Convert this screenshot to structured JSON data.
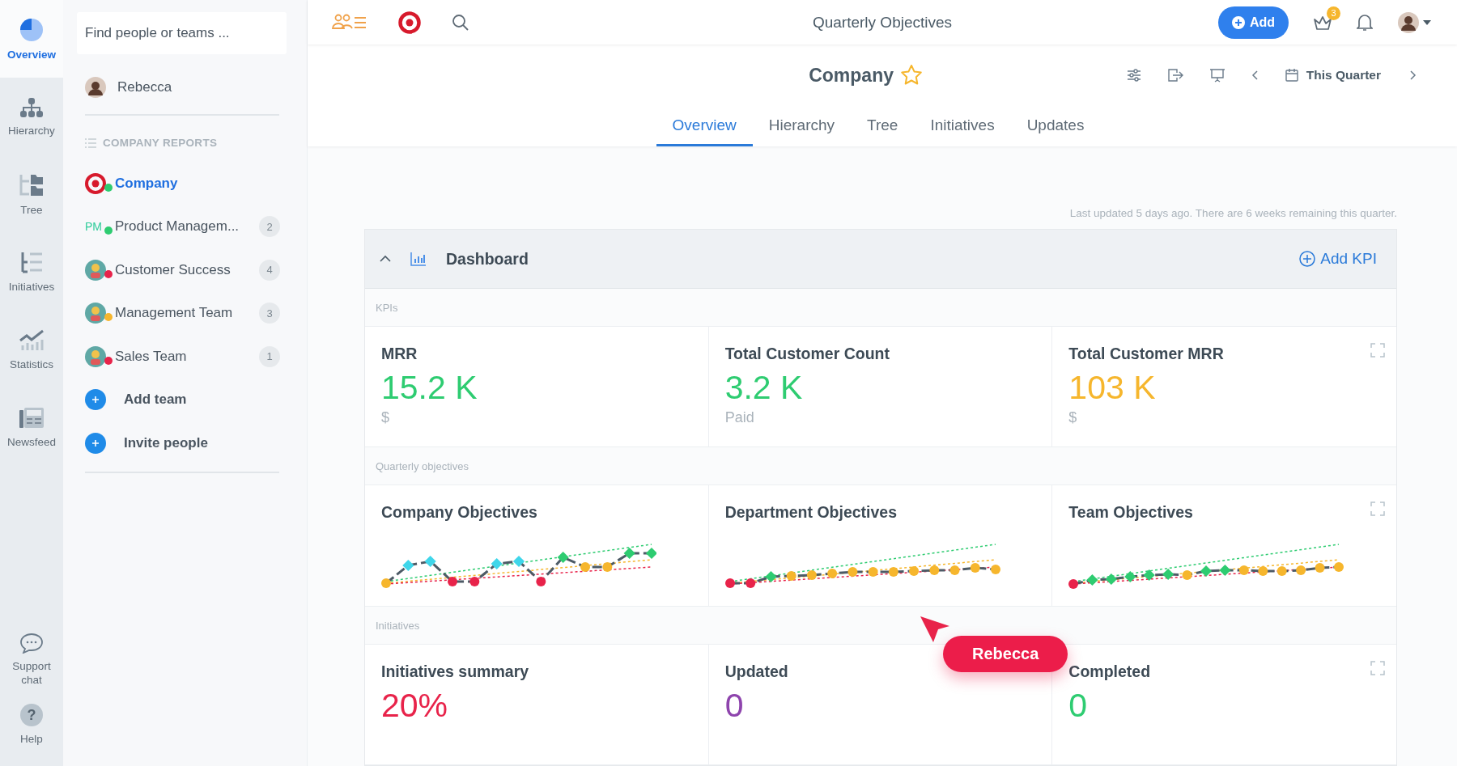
{
  "rail": {
    "items": [
      {
        "label": "Overview",
        "selected": true
      },
      {
        "label": "Hierarchy",
        "selected": false
      },
      {
        "label": "Tree",
        "selected": false
      },
      {
        "label": "Initiatives",
        "selected": false
      },
      {
        "label": "Statistics",
        "selected": false
      },
      {
        "label": "Newsfeed",
        "selected": false
      }
    ],
    "bottom": [
      {
        "label": "Support chat"
      },
      {
        "label": "Help",
        "glyph": "?"
      }
    ]
  },
  "sidebar": {
    "search": {
      "placeholder": "Find people or teams ..."
    },
    "user": "Rebecca",
    "section": "COMPANY REPORTS",
    "teams": [
      {
        "kind": "target",
        "name": "Company",
        "color": "#2ecc71",
        "selected": true
      },
      {
        "kind": "initials",
        "initials": "PM",
        "name": "Product Managem...",
        "count": "2",
        "color": "#2ecc71",
        "selected": false
      },
      {
        "kind": "avatar",
        "name": "Customer Success",
        "count": "4",
        "color": "#e8234a",
        "selected": false
      },
      {
        "kind": "avatar",
        "name": "Management Team",
        "count": "3",
        "color": "#f6b62d",
        "selected": false
      },
      {
        "kind": "avatar",
        "name": "Sales Team",
        "count": "1",
        "color": "#e8234a",
        "selected": false
      }
    ],
    "actions": [
      "Add team",
      "Invite people"
    ]
  },
  "topbar": {
    "title": "Quarterly Objectives",
    "add_button": "Add",
    "cart_badge": "3"
  },
  "header": {
    "title": "Company",
    "period": "This Quarter",
    "tabs": [
      {
        "label": "Overview",
        "selected": true
      },
      {
        "label": "Hierarchy",
        "selected": false
      },
      {
        "label": "Tree",
        "selected": false
      },
      {
        "label": "Initiatives",
        "selected": false
      },
      {
        "label": "Updates",
        "selected": false
      }
    ]
  },
  "dashboard": {
    "note": "Last updated 5 days ago. There are 6 weeks remaining this quarter.",
    "title": "Dashboard",
    "expanded": true,
    "add_kpi": "Add KPI",
    "sections": [
      {
        "label": "KPIs",
        "cards": [
          {
            "kind": "metric",
            "title": "MRR",
            "value": "15.2 K",
            "unit": "$",
            "color": "#2ecc71"
          },
          {
            "kind": "metric",
            "title": "Total Customer Count",
            "value": "3.2 K",
            "unit": "Paid",
            "color": "#2ecc71"
          },
          {
            "kind": "metric",
            "title": "Total Customer MRR",
            "value": "103 K",
            "unit": "$",
            "color": "#f6b62d"
          }
        ]
      },
      {
        "label": "Quarterly objectives",
        "cards": [
          {
            "kind": "sparkline",
            "title": "Company Objectives"
          },
          {
            "kind": "sparkline",
            "title": "Department Objectives"
          },
          {
            "kind": "sparkline",
            "title": "Team Objectives"
          }
        ]
      },
      {
        "label": "Initiatives",
        "cards": [
          {
            "kind": "metric",
            "title": "Initiatives summary",
            "value": "20%",
            "color": "#e8234a"
          },
          {
            "kind": "metric",
            "title": "Updated",
            "value": "0",
            "color": "#8e44ad"
          },
          {
            "kind": "metric",
            "title": "Completed",
            "value": "0",
            "color": "#2ecc71"
          }
        ]
      }
    ]
  },
  "cursor_label": "Rebecca"
}
